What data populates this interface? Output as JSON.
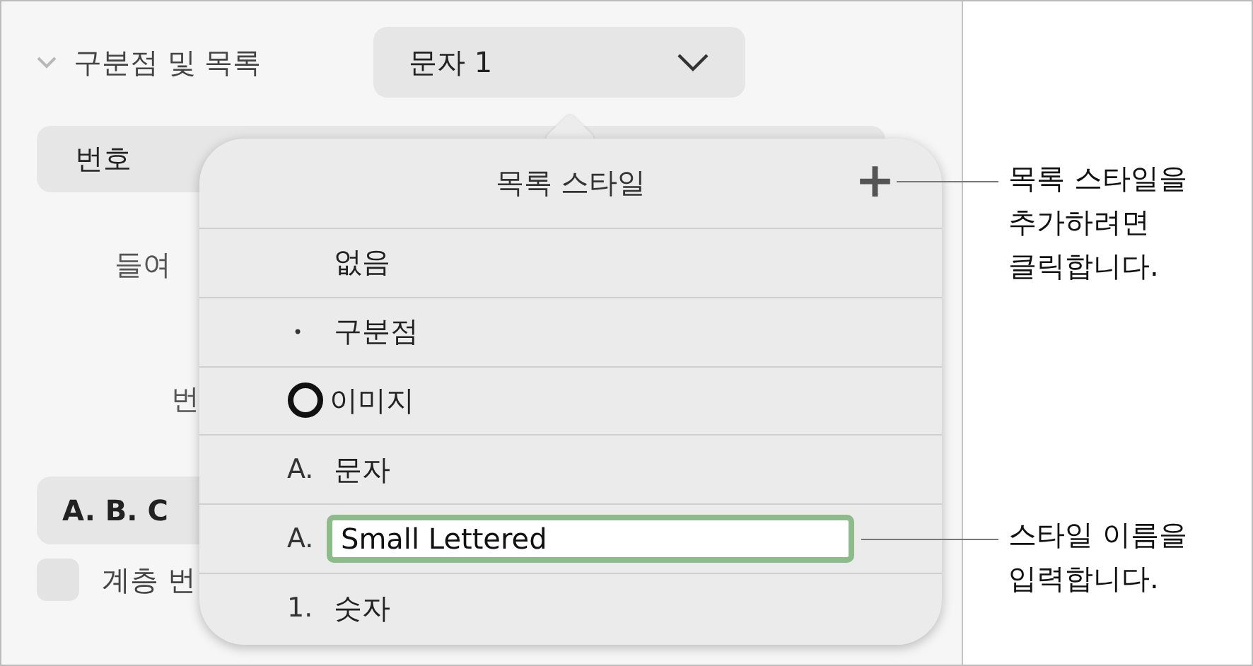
{
  "sidebar": {
    "section": {
      "title": "구분점 및 목록",
      "expanded": true,
      "style_popup": "문자 1"
    },
    "bar_label": "번호",
    "indent_label": "들여",
    "number_label": "번",
    "format_button": "A. B. C",
    "tiered": {
      "label": "계층 번",
      "checked": false
    }
  },
  "popover": {
    "title": "목록 스타일",
    "add": "+",
    "rows": [
      {
        "kind": "none",
        "label": "없음"
      },
      {
        "kind": "text",
        "marker": "•",
        "label": "구분점"
      },
      {
        "kind": "image",
        "label": "이미지"
      },
      {
        "kind": "text",
        "marker": "A.",
        "label": "문자"
      },
      {
        "kind": "input",
        "marker": "A.",
        "value": "Small Lettered"
      },
      {
        "kind": "text",
        "marker": "1.",
        "label": "숫자"
      }
    ]
  },
  "callouts": [
    {
      "text": "목록 스타일을 추가하려면 클릭합니다."
    },
    {
      "text": "스타일 이름을 입력합니다."
    }
  ]
}
